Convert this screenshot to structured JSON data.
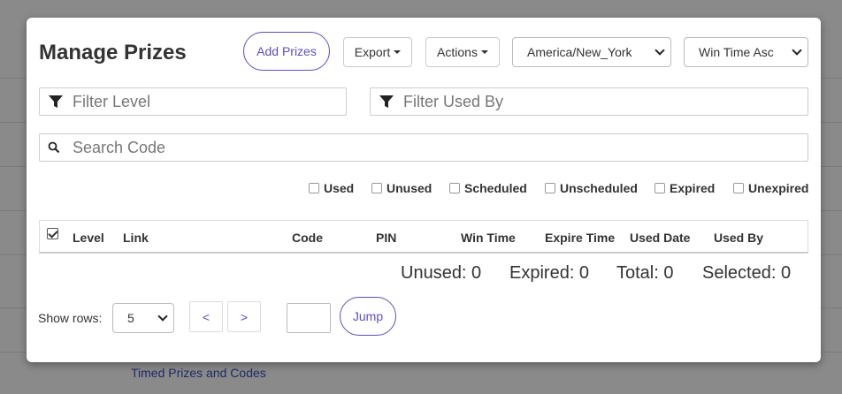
{
  "background": {
    "link_text": "Timed Prizes and Codes"
  },
  "modal": {
    "title": "Manage Prizes",
    "add_prizes_label": "Add Prizes",
    "export_label": "Export",
    "actions_label": "Actions",
    "timezone_value": "America/New_York",
    "sort_value": "Win Time Asc",
    "filter_level_placeholder": "Filter Level",
    "filter_used_by_placeholder": "Filter Used By",
    "search_placeholder": "Search Code",
    "status_filters": [
      "Used",
      "Unused",
      "Scheduled",
      "Unscheduled",
      "Expired",
      "Unexpired"
    ],
    "columns": [
      "Level",
      "Link",
      "Code",
      "PIN",
      "Win Time",
      "Expire Time",
      "Used Date",
      "Used By"
    ],
    "stats": {
      "unused": "Unused: 0",
      "expired": "Expired: 0",
      "total": "Total: 0",
      "selected": "Selected: 0"
    },
    "pagination": {
      "show_rows_label": "Show rows:",
      "rows_value": "5",
      "prev_label": "<",
      "next_label": ">",
      "page_value": "",
      "jump_label": "Jump"
    }
  },
  "colors": {
    "accent": "#5b4fc4",
    "overlay": "#8a8a8a"
  }
}
